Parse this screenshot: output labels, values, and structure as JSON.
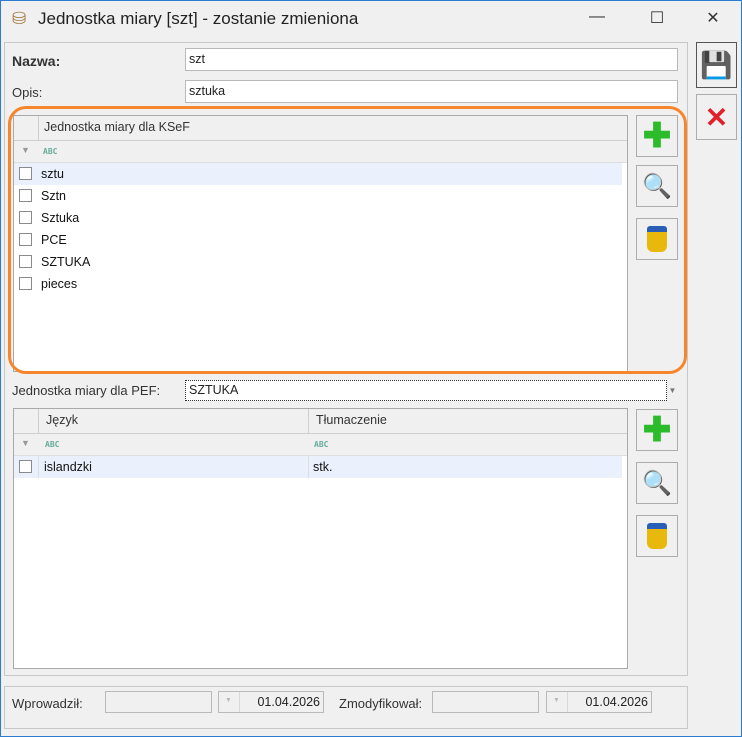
{
  "window": {
    "title": "Jednostka miary [szt] - zostanie zmieniona",
    "minimize": "—",
    "maximize": "☐",
    "close": "✕"
  },
  "form": {
    "nazwa_label": "Nazwa:",
    "nazwa_value": "szt",
    "opis_label": "Opis:",
    "opis_value": "sztuka"
  },
  "ksef_grid": {
    "header": "Jednostka miary dla KSeF",
    "rows": [
      "sztu",
      "Sztn",
      "Sztuka",
      "PCE",
      "SZTUKA",
      "pieces"
    ]
  },
  "pef": {
    "label": "Jednostka miary dla PEF:",
    "value": "SZTUKA"
  },
  "lang_grid": {
    "headers": [
      "Język",
      "Tłumaczenie"
    ],
    "rows": [
      [
        "islandzki",
        "stk."
      ]
    ]
  },
  "footer": {
    "entered_label": "Wprowadził:",
    "entered_date": "01.04.2026",
    "modified_label": "Zmodyfikował:",
    "modified_date": "01.04.2026"
  },
  "colors": {
    "highlight": "#f7852b",
    "border": "#2b7bd0"
  }
}
